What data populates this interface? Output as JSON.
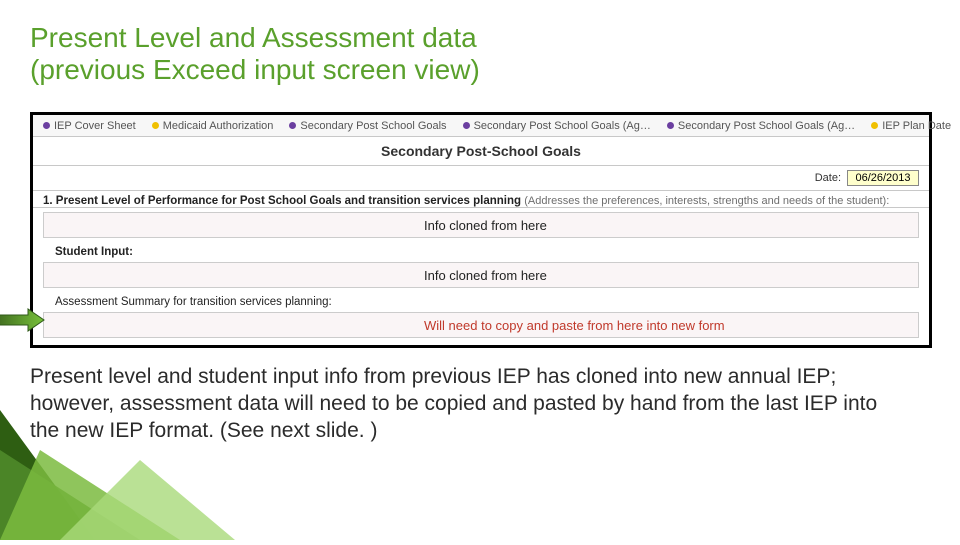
{
  "title_line1": "Present Level and Assessment data",
  "title_line2": "(previous Exceed input screen view)",
  "tabs": [
    {
      "label": "IEP Cover Sheet",
      "dot": "purple"
    },
    {
      "label": "Medicaid Authorization",
      "dot": "yellow"
    },
    {
      "label": "Secondary Post School Goals",
      "dot": "purple"
    },
    {
      "label": "Secondary Post School Goals (Ag…",
      "dot": "purple"
    },
    {
      "label": "Secondary Post School Goals (Ag…",
      "dot": "purple"
    },
    {
      "label": "IEP Plan Date",
      "dot": "yellow"
    }
  ],
  "section_header": "Secondary Post-School Goals",
  "date_label": "Date:",
  "date_value": "06/26/2013",
  "question1_num": "1.",
  "question1_label": "Present Level of Performance for Post School Goals and transition services planning",
  "question1_desc": "(Addresses the preferences, interests, strengths and needs of the student):",
  "answer1": "Info cloned from here",
  "student_input_label": "Student Input:",
  "answer2": "Info cloned from here",
  "assessment_label": "Assessment Summary for transition services planning:",
  "answer3": "Will need to copy and paste from here into new form",
  "body_text": "Present level and student input info from previous IEP has cloned into new annual IEP; however, assessment data will need to be copied and pasted by hand from the last IEP into the new IEP format. (See next slide. )",
  "colors": {
    "title": "#5aa02c",
    "arrow": "#5aa02c",
    "warning": "#c0392b"
  }
}
